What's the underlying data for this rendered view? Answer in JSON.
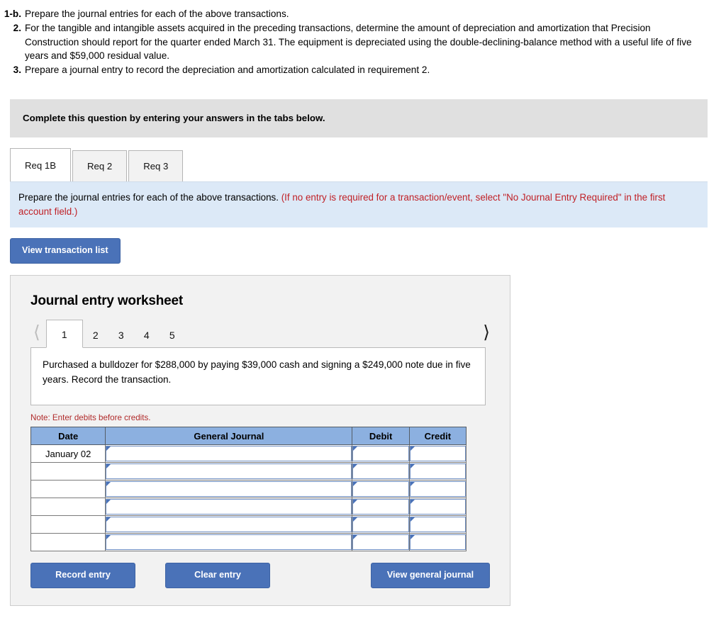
{
  "requirements": [
    {
      "num": "1-b.",
      "text": "Prepare the journal entries for each of the above transactions."
    },
    {
      "num": "2.",
      "text": "For the tangible and intangible assets acquired in the preceding transactions, determine the amount of depreciation and amortization that Precision Construction should report for the quarter ended March 31. The equipment is depreciated using the double-declining-balance method with a useful life of five years and $59,000 residual value."
    },
    {
      "num": "3.",
      "text": "Prepare a journal entry to record the depreciation and amortization calculated in requirement 2."
    }
  ],
  "gray_banner": {
    "text": "Complete this question by entering your answers in the tabs below."
  },
  "tabs": [
    {
      "label": "Req 1B",
      "active": true
    },
    {
      "label": "Req 2",
      "active": false
    },
    {
      "label": "Req 3",
      "active": false
    }
  ],
  "instruction": {
    "main": "Prepare the journal entries for each of the above transactions.",
    "hint": "(If no entry is required for a transaction/event, select \"No Journal Entry Required\" in the first account field.)"
  },
  "buttons": {
    "view_transaction_list": "View transaction list",
    "record_entry": "Record entry",
    "clear_entry": "Clear entry",
    "view_general_journal": "View general journal"
  },
  "worksheet": {
    "title": "Journal entry worksheet",
    "pager": {
      "prev_icon": "chevron-left",
      "next_icon": "chevron-right",
      "prev_enabled": false,
      "next_enabled": true,
      "pages": [
        "1",
        "2",
        "3",
        "4",
        "5"
      ],
      "active_page": "1"
    },
    "transaction_text": "Purchased a bulldozer for $288,000 by paying $39,000 cash and signing a $249,000 note due in five years. Record the transaction.",
    "note": "Note: Enter debits before credits.",
    "table": {
      "headers": [
        "Date",
        "General Journal",
        "Debit",
        "Credit"
      ],
      "rows": [
        {
          "date": "January 02",
          "general_journal": "",
          "debit": "",
          "credit": ""
        },
        {
          "date": "",
          "general_journal": "",
          "debit": "",
          "credit": ""
        },
        {
          "date": "",
          "general_journal": "",
          "debit": "",
          "credit": ""
        },
        {
          "date": "",
          "general_journal": "",
          "debit": "",
          "credit": ""
        },
        {
          "date": "",
          "general_journal": "",
          "debit": "",
          "credit": ""
        },
        {
          "date": "",
          "general_journal": "",
          "debit": "",
          "credit": ""
        }
      ]
    }
  },
  "colors": {
    "button_blue": "#4a72b8",
    "table_header_blue": "#8cb0e0",
    "banner_gray": "#e0e0e0",
    "banner_light_blue": "#dce9f7",
    "note_red": "#b02a2a",
    "hint_red": "#c02026"
  }
}
